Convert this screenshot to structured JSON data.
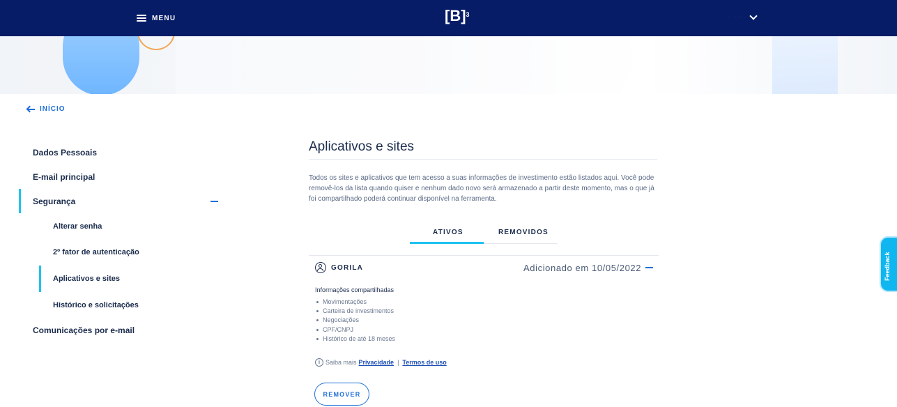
{
  "header": {
    "menu_label": "MENU",
    "logo_text": "[B]",
    "logo_sup": "3",
    "user_name": "· · ·"
  },
  "nav": {
    "back_label": "INÍCIO"
  },
  "sidebar": {
    "items": [
      {
        "label": "Dados Pessoais"
      },
      {
        "label": "E-mail principal"
      },
      {
        "label": "Segurança",
        "expanded": true
      },
      {
        "label": "Comunicações por e-mail"
      }
    ],
    "security_subitems": [
      {
        "label": "Alterar senha"
      },
      {
        "label": "2º fator de autenticação"
      },
      {
        "label": "Aplicativos e sites",
        "active": true
      },
      {
        "label": "Histórico e solicitações"
      }
    ]
  },
  "main": {
    "title": "Aplicativos e sites",
    "description": "Todos os sites e aplicativos que tem acesso a suas informações de investimento estão listados aqui. Você pode removê-los da lista quando quiser e nenhum dado novo será armazenado a partir deste momento, mas o que já foi compartilhado poderá continuar disponível na ferramenta.",
    "tabs": [
      {
        "label": "ATIVOS",
        "active": true
      },
      {
        "label": "REMOVIDOS",
        "active": false
      }
    ],
    "app": {
      "name": "GORILA",
      "added": "Adicionado em 10/05/2022",
      "shared_title": "Informações compartilhadas",
      "shared_items": [
        "Movimentações",
        "Carteira de investimentos",
        "Negociações",
        "CPF/CNPJ",
        "Histórico de até 18 meses"
      ],
      "info_prefix": "Saiba mais",
      "privacy_link": "Privacidade",
      "separator": "|",
      "terms_link": "Termos de uso",
      "remove_label": "REMOVER"
    }
  },
  "feedback": {
    "label": "Feedback"
  },
  "colors": {
    "topbar": "#071c67",
    "accent_blue": "#1e6fd9",
    "active_cyan": "#1ec3f0",
    "feedback": "#10b6ef"
  }
}
